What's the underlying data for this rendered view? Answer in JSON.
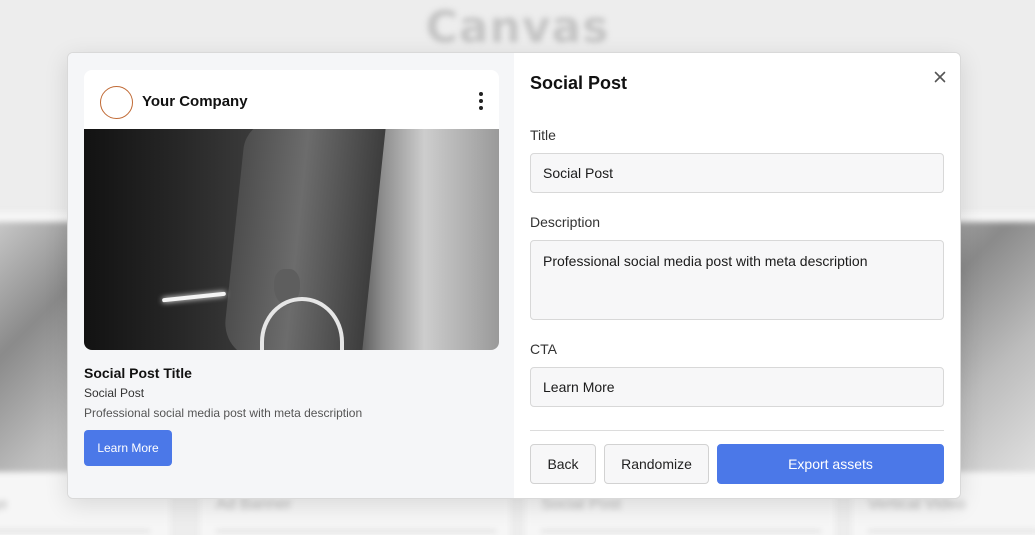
{
  "background": {
    "title": "Canvas",
    "cards": [
      {
        "label": "ge"
      },
      {
        "label": "Ad Banner"
      },
      {
        "label": "Social Post"
      },
      {
        "label": "Vertical Video"
      }
    ]
  },
  "preview": {
    "company_name": "Your Company",
    "post_title": "Social Post Title",
    "post_subtitle": "Social Post",
    "post_description": "Professional social media post with meta description",
    "cta_label": "Learn More"
  },
  "form": {
    "heading": "Social Post",
    "title_label": "Title",
    "title_value": "Social Post",
    "description_label": "Description",
    "description_value": "Professional social media post with meta description",
    "cta_label": "CTA",
    "cta_value": "Learn More"
  },
  "actions": {
    "back_label": "Back",
    "randomize_label": "Randomize",
    "export_label": "Export assets"
  },
  "icons": {
    "close": "close-icon",
    "menu": "kebab-menu-icon"
  },
  "colors": {
    "accent": "#4b78e8",
    "avatar_ring": "#c06a35"
  }
}
